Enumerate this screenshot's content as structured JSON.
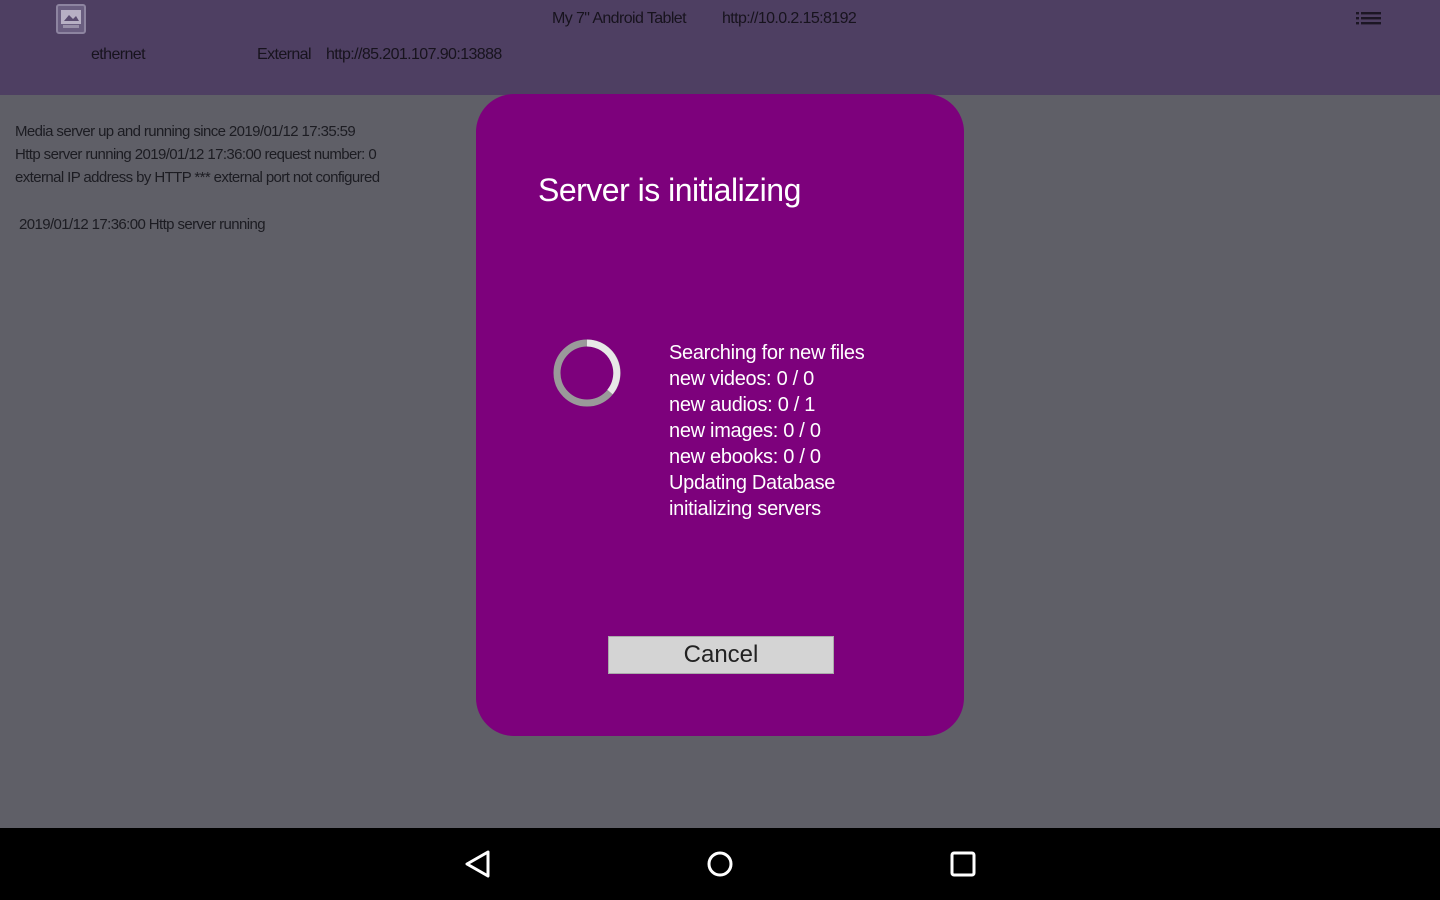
{
  "header": {
    "device_name": "My 7\" Android Tablet",
    "local_url": "http://10.0.2.15:8192",
    "network_type": "ethernet",
    "external_label": "External",
    "external_url": "http://85.201.107.90:13888",
    "app_icon": "media-server-app-icon",
    "menu_icon": "list-menu-icon"
  },
  "status_log": {
    "lines": [
      "Media server up and running since 2019/01/12 17:35:59",
      "Http server running 2019/01/12 17:36:00   request number: 0",
      "external IP address by HTTP *** external port not configured"
    ],
    "event": "2019/01/12 17:36:00 Http server running"
  },
  "dialog": {
    "title": "Server is initializing",
    "progress": [
      "Searching for new files",
      "new videos: 0 / 0",
      "new audios: 0 / 1",
      "new images: 0 / 0",
      "new ebooks: 0 / 0",
      "Updating Database",
      "initializing servers"
    ],
    "cancel_label": "Cancel",
    "spinner_icon": "loading-spinner-icon"
  },
  "nav_bar": {
    "back_icon": "back-triangle-icon",
    "home_icon": "home-circle-icon",
    "recents_icon": "recents-square-icon"
  },
  "colors": {
    "header_bg": "#4e3f62",
    "screen_bg": "#5f5f67",
    "dialog_bg": "#7d017c",
    "nav_bg": "#000000"
  }
}
